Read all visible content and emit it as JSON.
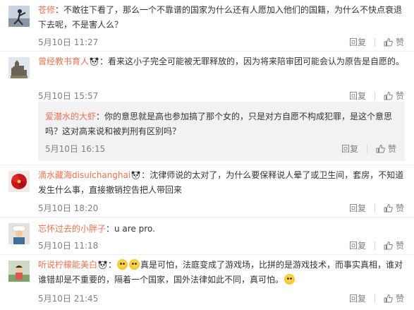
{
  "comments": [
    {
      "username": "苍修",
      "text": "：不敢往下看了，那么一个不靠谱的国家为什么还有人愿加入他们的国籍，为什么不快点衰退下去呢，不是害人么？",
      "time": "5月10日 11:27",
      "reply_label": "回复",
      "like_label": "赞",
      "avatar_icon": "dancer-avatar"
    },
    {
      "username": "曾经教书育人",
      "text": "：看来这小子完全可能被无罪释放的，因为将来陪审团可能会认为原告是自愿的。",
      "time": "5月10日 15:57",
      "reply_label": "回复",
      "like_label": "赞",
      "avatar_icon": "building-avatar",
      "badge_icon": "panda-icon"
    },
    {
      "username": "爱潜水的大虾",
      "text": "：你的意思就是高也参加搞了那个女的，只是对方自愿不构成犯罪，是这个意思吗？这对高来说和被判刑有区别吗？",
      "time": "5月10日 16:15",
      "reply_label": "回复",
      "like_label": "赞"
    },
    {
      "username": "滴水藏海disuichanghai",
      "text": "：沈律师说的太对了，为什么要保释说人晕了或卫生间，套房，不知道发生什么事，直接撤销控告把人带回来",
      "time": "5月10日 18:20",
      "reply_label": "回复",
      "like_label": "赞",
      "avatar_icon": "flower-avatar",
      "badge_icon": "panda-icon"
    },
    {
      "username": "忘怀过去的小胖子",
      "text": "：u are pro.",
      "time": "5月10日 11:18",
      "reply_label": "回复",
      "like_label": "赞",
      "avatar_icon": "chef-avatar"
    },
    {
      "username": "听说柠檬能美白",
      "text_before": "：",
      "text_main": "真是可怕，法庭变成了游戏场，比拼的是游戏技术，而事实真相，谁对谁错却是不重要的，隔着一个国家，国外法律如此不同，真可怕。",
      "time": "5月10日 21:45",
      "reply_label": "回复",
      "like_label": "赞",
      "avatar_icon": "kid-avatar",
      "badge_icon": "panda-icon",
      "emoji_icon": "doge-emoji"
    }
  ],
  "colors": {
    "username": "#eb7350",
    "text": "#333333",
    "meta": "#808080",
    "reply_bg": "#f2f2f5"
  }
}
